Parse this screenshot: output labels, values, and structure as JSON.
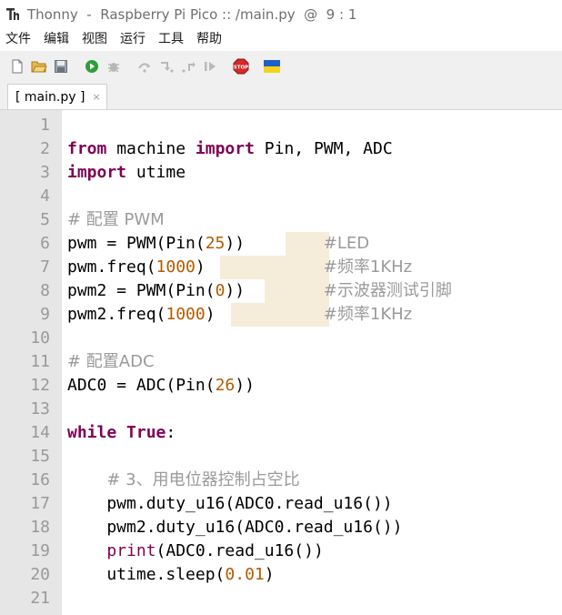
{
  "window": {
    "title": "Thonny  -  Raspberry Pi Pico :: /main.py  @  9 : 1"
  },
  "menu": [
    "文件",
    "编辑",
    "视图",
    "运行",
    "工具",
    "帮助"
  ],
  "toolbar": {
    "buttons": [
      "new-file-icon",
      "open-file-icon",
      "save-icon",
      "run-icon",
      "debug-icon",
      "step-over-icon",
      "step-into-icon",
      "step-out-icon",
      "resume-icon",
      "stop-icon",
      "ukraine-flag-icon"
    ],
    "stop_label": "STOP"
  },
  "tabs": [
    {
      "label": "[ main.py ]",
      "close": "×"
    }
  ],
  "editor": {
    "line_numbers": [
      "1",
      "2",
      "3",
      "4",
      "5",
      "6",
      "7",
      "8",
      "9",
      "10",
      "11",
      "12",
      "13",
      "14",
      "15",
      "16",
      "17",
      "18",
      "19",
      "20",
      "21"
    ],
    "lines": [
      [],
      [
        {
          "t": "from",
          "c": "kw"
        },
        {
          "t": " machine ",
          "c": ""
        },
        {
          "t": "import",
          "c": "kw"
        },
        {
          "t": " Pin, PWM, ADC",
          "c": ""
        }
      ],
      [
        {
          "t": "import",
          "c": "kw"
        },
        {
          "t": " utime",
          "c": ""
        }
      ],
      [],
      [
        {
          "t": "# 配置 PWM",
          "c": "cmt"
        }
      ],
      [
        {
          "t": "pwm = PWM(Pin(",
          "c": ""
        },
        {
          "t": "25",
          "c": "num"
        },
        {
          "t": "))",
          "c": ""
        },
        {
          "t": "        ",
          "c": ""
        },
        {
          "t": "#LED",
          "c": "cmt"
        }
      ],
      [
        {
          "t": "pwm.freq(",
          "c": ""
        },
        {
          "t": "1000",
          "c": "num"
        },
        {
          "t": ")",
          "c": ""
        },
        {
          "t": "            ",
          "c": ""
        },
        {
          "t": "#频率1KHz",
          "c": "cmt"
        }
      ],
      [
        {
          "t": "pwm2 = PWM(Pin(",
          "c": ""
        },
        {
          "t": "0",
          "c": "num"
        },
        {
          "t": "))",
          "c": ""
        },
        {
          "t": "        ",
          "c": ""
        },
        {
          "t": "#示波器测试引脚",
          "c": "cmt"
        }
      ],
      [
        {
          "t": "pwm2.freq(",
          "c": ""
        },
        {
          "t": "1000",
          "c": "num"
        },
        {
          "t": ")",
          "c": ""
        },
        {
          "t": "           ",
          "c": ""
        },
        {
          "t": "#频率1KHz",
          "c": "cmt"
        }
      ],
      [],
      [
        {
          "t": "# 配置ADC",
          "c": "cmt"
        }
      ],
      [
        {
          "t": "ADC0 = ADC(Pin(",
          "c": ""
        },
        {
          "t": "26",
          "c": "num"
        },
        {
          "t": "))",
          "c": ""
        }
      ],
      [],
      [
        {
          "t": "while",
          "c": "kw"
        },
        {
          "t": " ",
          "c": ""
        },
        {
          "t": "True",
          "c": "kw"
        },
        {
          "t": ":",
          "c": ""
        }
      ],
      [],
      [
        {
          "t": "    ",
          "c": ""
        },
        {
          "t": "# 3、用电位器控制占空比",
          "c": "cmt"
        }
      ],
      [
        {
          "t": "    pwm.duty_u16(ADC0.read_u16())",
          "c": ""
        }
      ],
      [
        {
          "t": "    pwm2.duty_u16(ADC0.read_u16())",
          "c": ""
        }
      ],
      [
        {
          "t": "    ",
          "c": ""
        },
        {
          "t": "print",
          "c": "kw-plain"
        },
        {
          "t": "(ADC0.read_u16())",
          "c": ""
        }
      ],
      [
        {
          "t": "    utime.sleep(",
          "c": ""
        },
        {
          "t": "0.01",
          "c": "num"
        },
        {
          "t": ")",
          "c": ""
        }
      ],
      []
    ]
  }
}
